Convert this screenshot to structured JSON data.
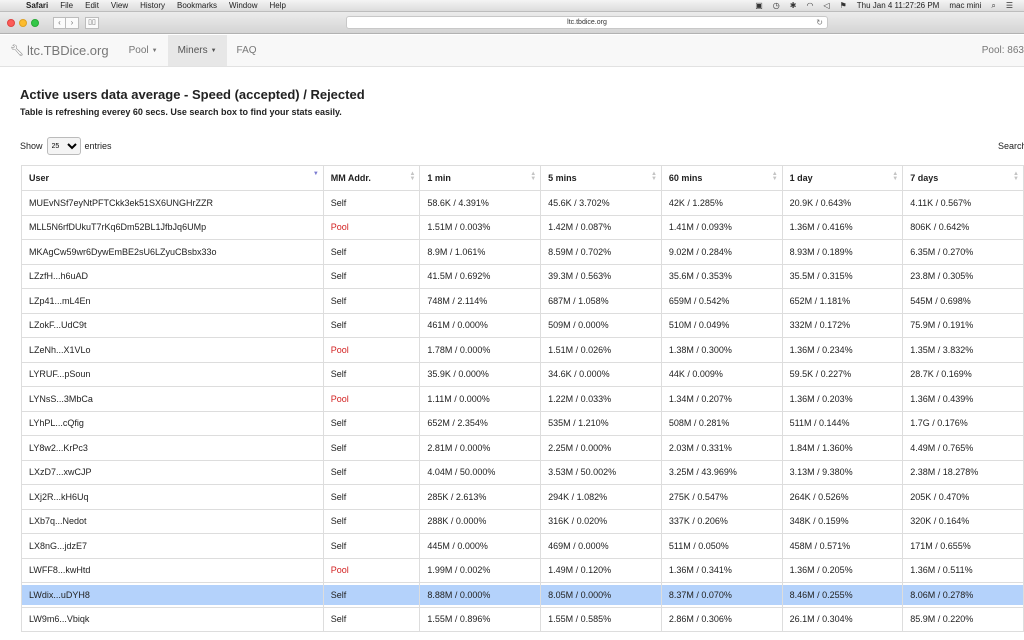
{
  "menubar": {
    "app": "Safari",
    "items": [
      "File",
      "Edit",
      "View",
      "History",
      "Bookmarks",
      "Window",
      "Help"
    ],
    "clock": "Thu Jan 4  11:27:26 PM",
    "user": "mac mini"
  },
  "browser": {
    "url": "ltc.tbdice.org"
  },
  "navbar": {
    "brand": "ltc.TBDice.org",
    "items": [
      {
        "label": "Pool",
        "dropdown": true,
        "active": false
      },
      {
        "label": "Miners",
        "dropdown": true,
        "active": true
      },
      {
        "label": "FAQ",
        "dropdown": false,
        "active": false
      }
    ],
    "pool_stat": "Pool: 863"
  },
  "page": {
    "title": "Active users data average - Speed (accepted) / Rejected",
    "subtitle": "Table is refreshing everey 60 secs. Use search box to find your stats easily.",
    "show_label": "Show",
    "entries_value": "25",
    "entries_label": "entries",
    "search_label": "Search:"
  },
  "table": {
    "columns": [
      "User",
      "MM Addr.",
      "1 min",
      "5 mins",
      "60 mins",
      "1 day",
      "7 days"
    ],
    "rows": [
      [
        "MUEvNSf7eyNtPFTCkk3ek51SX6UNGHrZZR",
        "Self",
        "58.6K / 4.391%",
        "45.6K / 3.702%",
        "42K / 1.285%",
        "20.9K / 0.643%",
        "4.11K / 0.567%"
      ],
      [
        "MLL5N6rfDUkuT7rKq6Dm52BL1JfbJq6UMp",
        "Pool",
        "1.51M / 0.003%",
        "1.42M / 0.087%",
        "1.41M / 0.093%",
        "1.36M / 0.416%",
        "806K / 0.642%"
      ],
      [
        "MKAgCw59wr6DywEmBE2sU6LZyuCBsbx33o",
        "Self",
        "8.9M / 1.061%",
        "8.59M / 0.702%",
        "9.02M / 0.284%",
        "8.93M / 0.189%",
        "6.35M / 0.270%"
      ],
      [
        "LZzfH...h6uAD",
        "Self",
        "41.5M / 0.692%",
        "39.3M / 0.563%",
        "35.6M / 0.353%",
        "35.5M / 0.315%",
        "23.8M / 0.305%"
      ],
      [
        "LZp41...mL4En",
        "Self",
        "748M / 2.114%",
        "687M / 1.058%",
        "659M / 0.542%",
        "652M / 1.181%",
        "545M / 0.698%"
      ],
      [
        "LZokF...UdC9t",
        "Self",
        "461M / 0.000%",
        "509M / 0.000%",
        "510M / 0.049%",
        "332M / 0.172%",
        "75.9M / 0.191%"
      ],
      [
        "LZeNh...X1VLo",
        "Pool",
        "1.78M / 0.000%",
        "1.51M / 0.026%",
        "1.38M / 0.300%",
        "1.36M / 0.234%",
        "1.35M / 3.832%"
      ],
      [
        "LYRUF...pSoun",
        "Self",
        "35.9K / 0.000%",
        "34.6K / 0.000%",
        "44K / 0.009%",
        "59.5K / 0.227%",
        "28.7K / 0.169%"
      ],
      [
        "LYNsS...3MbCa",
        "Pool",
        "1.11M / 0.000%",
        "1.22M / 0.033%",
        "1.34M / 0.207%",
        "1.36M / 0.203%",
        "1.36M / 0.439%"
      ],
      [
        "LYhPL...cQfig",
        "Self",
        "652M / 2.354%",
        "535M / 1.210%",
        "508M / 0.281%",
        "511M / 0.144%",
        "1.7G / 0.176%"
      ],
      [
        "LY8w2...KrPc3",
        "Self",
        "2.81M / 0.000%",
        "2.25M / 0.000%",
        "2.03M / 0.331%",
        "1.84M / 1.360%",
        "4.49M / 0.765%"
      ],
      [
        "LXzD7...xwCJP",
        "Self",
        "4.04M / 50.000%",
        "3.53M / 50.002%",
        "3.25M / 43.969%",
        "3.13M / 9.380%",
        "2.38M / 18.278%"
      ],
      [
        "LXj2R...kH6Uq",
        "Self",
        "285K / 2.613%",
        "294K / 1.082%",
        "275K / 0.547%",
        "264K / 0.526%",
        "205K / 0.470%"
      ],
      [
        "LXb7q...Nedot",
        "Self",
        "288K / 0.000%",
        "316K / 0.020%",
        "337K / 0.206%",
        "348K / 0.159%",
        "320K / 0.164%"
      ],
      [
        "LX8nG...jdzE7",
        "Self",
        "445M / 0.000%",
        "469M / 0.000%",
        "511M / 0.050%",
        "458M / 0.571%",
        "171M / 0.655%"
      ],
      [
        "LWFF8...kwHtd",
        "Pool",
        "1.99M / 0.002%",
        "1.49M / 0.120%",
        "1.36M / 0.341%",
        "1.36M / 0.205%",
        "1.36M / 0.511%"
      ],
      [
        "LWdix...uDYH8",
        "Self",
        "8.88M / 0.000%",
        "8.05M / 0.000%",
        "8.37M / 0.070%",
        "8.46M / 0.255%",
        "8.06M / 0.278%"
      ],
      [
        "LW9m6...Vbiqk",
        "Self",
        "1.55M / 0.896%",
        "1.55M / 0.585%",
        "2.86M / 0.306%",
        "26.1M / 0.304%",
        "85.9M / 0.220%"
      ]
    ],
    "selected_row_index": 16,
    "sorted_column_index": 0,
    "colors": {
      "pool_text": "#d21f1f",
      "selection": "#b4d2fb"
    }
  }
}
